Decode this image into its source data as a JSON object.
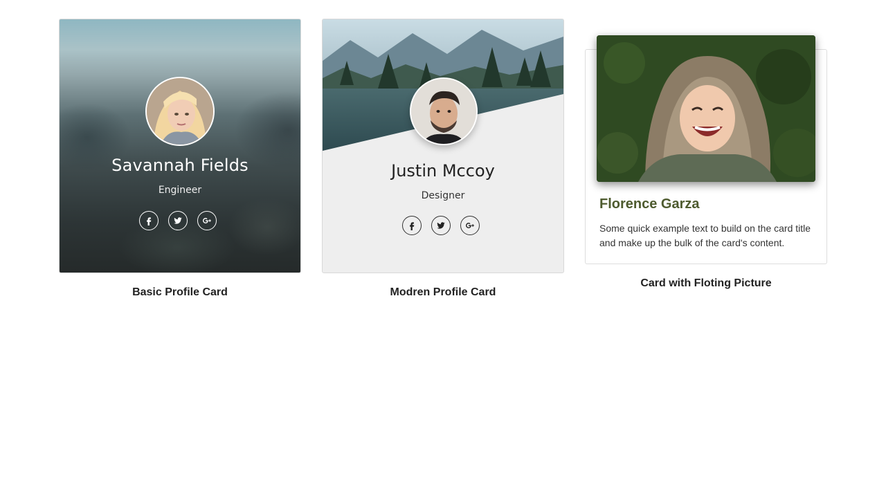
{
  "cards": {
    "basic": {
      "name": "Savannah Fields",
      "role": "Engineer",
      "caption": "Basic Profile Card",
      "social": [
        "facebook",
        "twitter",
        "google-plus"
      ]
    },
    "modern": {
      "name": "Justin Mccoy",
      "role": "Designer",
      "caption": "Modren Profile Card",
      "social": [
        "facebook",
        "twitter",
        "google-plus"
      ]
    },
    "floating": {
      "title": "Florence Garza",
      "text": "Some quick example text to build on the card title and make up the bulk of the card's content.",
      "caption": "Card with Floting Picture"
    }
  },
  "icons": {
    "facebook": "facebook-icon",
    "twitter": "twitter-icon",
    "google_plus": "google-plus-icon"
  },
  "colors": {
    "floating_title": "#4e5b2f",
    "modern_card_bg": "#eeeeee",
    "caption_text": "#222222"
  }
}
